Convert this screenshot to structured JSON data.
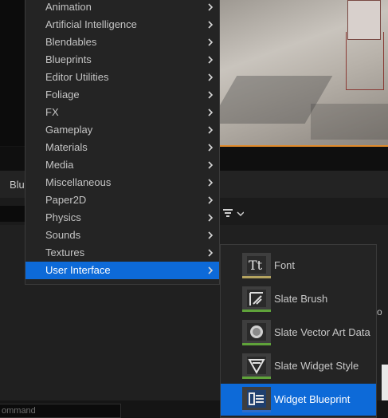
{
  "main_menu": {
    "items": [
      {
        "label": "Animation"
      },
      {
        "label": "Artificial Intelligence"
      },
      {
        "label": "Blendables"
      },
      {
        "label": "Blueprints"
      },
      {
        "label": "Editor Utilities"
      },
      {
        "label": "Foliage"
      },
      {
        "label": "FX"
      },
      {
        "label": "Gameplay"
      },
      {
        "label": "Materials"
      },
      {
        "label": "Media"
      },
      {
        "label": "Miscellaneous"
      },
      {
        "label": "Paper2D"
      },
      {
        "label": "Physics"
      },
      {
        "label": "Sounds"
      },
      {
        "label": "Textures"
      },
      {
        "label": "User Interface",
        "selected": true
      }
    ]
  },
  "submenu": {
    "items": [
      {
        "label": "Font",
        "icon": "font-icon",
        "accent": "#b5a460"
      },
      {
        "label": "Slate Brush",
        "icon": "slate-brush-icon",
        "accent": "#5fa33a"
      },
      {
        "label": "Slate Vector Art Data",
        "icon": "vector-art-icon",
        "accent": "#5fa33a"
      },
      {
        "label": "Slate Widget Style",
        "icon": "widget-style-icon",
        "accent": "#5fa33a"
      },
      {
        "label": "Widget Blueprint",
        "icon": "widget-blueprint-icon",
        "accent": "#2f6cc8",
        "selected": true
      }
    ]
  },
  "background": {
    "tab_label": "Blu",
    "right_edge_text": "o",
    "command_placeholder": "ommand"
  },
  "colors": {
    "selection": "#0d6ad8",
    "viewport_border": "#e08a2a"
  }
}
